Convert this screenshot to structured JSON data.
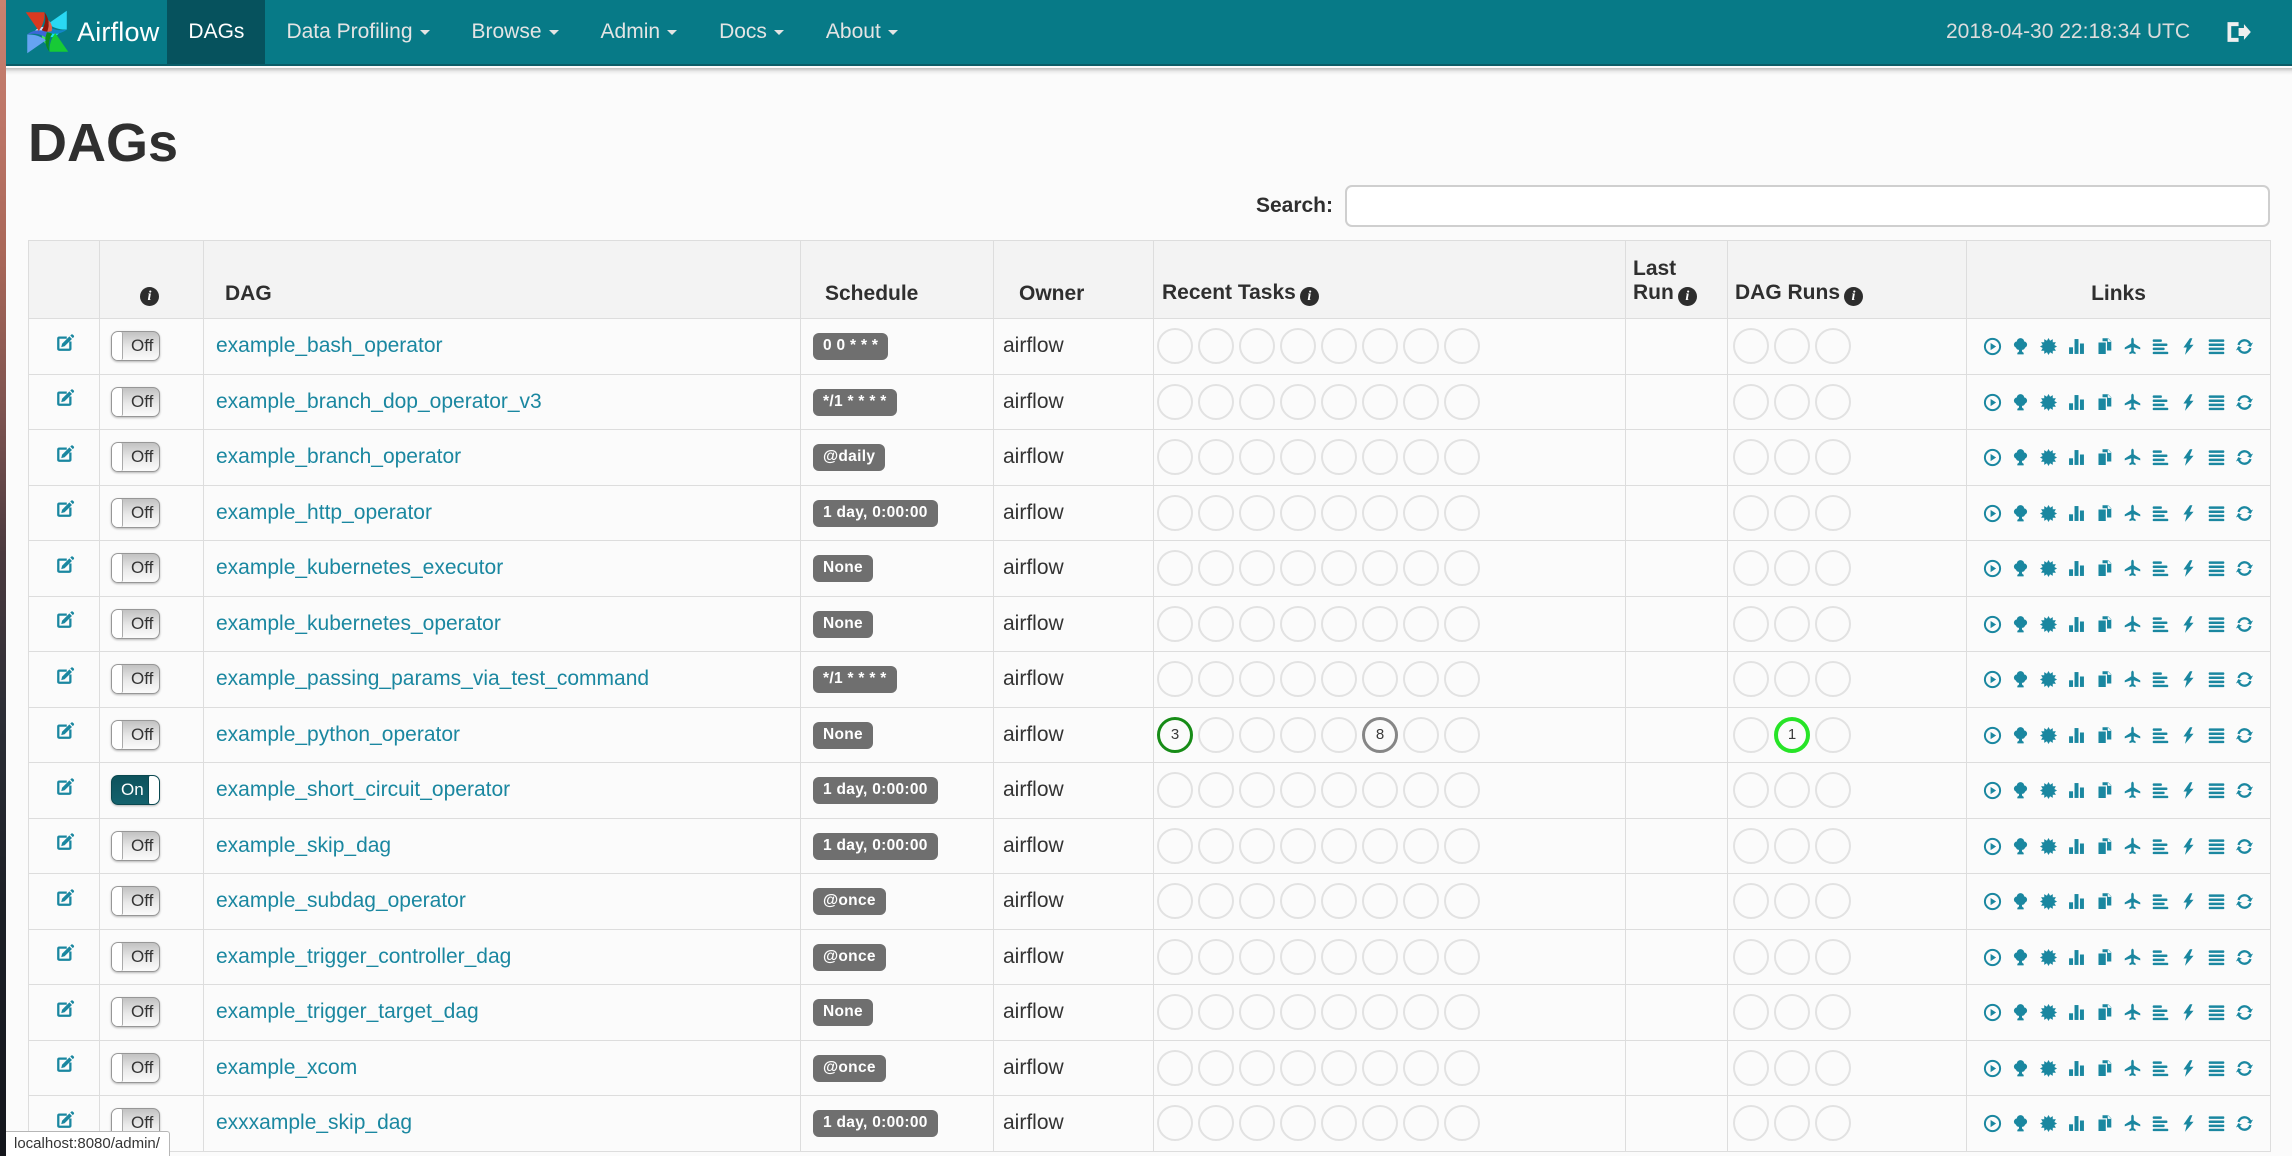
{
  "colors": {
    "accent": "#1a87a0",
    "navbar_bg": "#077a87",
    "navbar_active_bg": "#06525d",
    "toggle_on_bg": "#115f6a",
    "badge_bg": "#6f6f6f",
    "state_success": "#178c17",
    "state_queued": "#868686",
    "state_running": "#27e427",
    "empty_circle": "#e2e2e2"
  },
  "navbar": {
    "brand": "Airflow",
    "items": [
      {
        "label": "DAGs",
        "active": true,
        "dropdown": false
      },
      {
        "label": "Data Profiling",
        "active": false,
        "dropdown": true
      },
      {
        "label": "Browse",
        "active": false,
        "dropdown": true
      },
      {
        "label": "Admin",
        "active": false,
        "dropdown": true
      },
      {
        "label": "Docs",
        "active": false,
        "dropdown": true
      },
      {
        "label": "About",
        "active": false,
        "dropdown": true
      }
    ],
    "clock": "2018-04-30 22:18:34 UTC"
  },
  "page": {
    "title": "DAGs",
    "search_label": "Search:",
    "search_value": "",
    "status_bar_text": "localhost:8080/admin/"
  },
  "table": {
    "headers": {
      "edit": "",
      "info": "",
      "dag": "DAG",
      "schedule": "Schedule",
      "owner": "Owner",
      "recent_tasks": "Recent Tasks",
      "last_run": "Last Run",
      "dag_runs": "DAG Runs",
      "links": "Links"
    },
    "recent_task_slots": 8,
    "dag_run_slots": 3,
    "toggle_on_label": "On",
    "toggle_off_label": "Off",
    "link_icons": [
      "play-circle",
      "tree",
      "burst",
      "bar-chart",
      "duplicate",
      "plane",
      "align-left",
      "flash",
      "align-justify",
      "refresh"
    ],
    "rows": [
      {
        "dag_id": "example_bash_operator",
        "schedule": "0 0 * * *",
        "owner": "airflow",
        "enabled": false,
        "last_run": "",
        "recent_tasks": [],
        "dag_runs": []
      },
      {
        "dag_id": "example_branch_dop_operator_v3",
        "schedule": "*/1 * * * *",
        "owner": "airflow",
        "enabled": false,
        "last_run": "",
        "recent_tasks": [],
        "dag_runs": []
      },
      {
        "dag_id": "example_branch_operator",
        "schedule": "@daily",
        "owner": "airflow",
        "enabled": false,
        "last_run": "",
        "recent_tasks": [],
        "dag_runs": []
      },
      {
        "dag_id": "example_http_operator",
        "schedule": "1 day, 0:00:00",
        "owner": "airflow",
        "enabled": false,
        "last_run": "",
        "recent_tasks": [],
        "dag_runs": []
      },
      {
        "dag_id": "example_kubernetes_executor",
        "schedule": "None",
        "owner": "airflow",
        "enabled": false,
        "last_run": "",
        "recent_tasks": [],
        "dag_runs": []
      },
      {
        "dag_id": "example_kubernetes_operator",
        "schedule": "None",
        "owner": "airflow",
        "enabled": false,
        "last_run": "",
        "recent_tasks": [],
        "dag_runs": []
      },
      {
        "dag_id": "example_passing_params_via_test_command",
        "schedule": "*/1 * * * *",
        "owner": "airflow",
        "enabled": false,
        "last_run": "",
        "recent_tasks": [],
        "dag_runs": []
      },
      {
        "dag_id": "example_python_operator",
        "schedule": "None",
        "owner": "airflow",
        "enabled": false,
        "last_run": "",
        "recent_tasks": [
          {
            "slot": 0,
            "state": "success",
            "count": "3"
          },
          {
            "slot": 5,
            "state": "queued",
            "count": "8"
          }
        ],
        "dag_runs": [
          {
            "slot": 1,
            "state": "running",
            "count": "1"
          }
        ]
      },
      {
        "dag_id": "example_short_circuit_operator",
        "schedule": "1 day, 0:00:00",
        "owner": "airflow",
        "enabled": true,
        "last_run": "",
        "recent_tasks": [],
        "dag_runs": []
      },
      {
        "dag_id": "example_skip_dag",
        "schedule": "1 day, 0:00:00",
        "owner": "airflow",
        "enabled": false,
        "last_run": "",
        "recent_tasks": [],
        "dag_runs": []
      },
      {
        "dag_id": "example_subdag_operator",
        "schedule": "@once",
        "owner": "airflow",
        "enabled": false,
        "last_run": "",
        "recent_tasks": [],
        "dag_runs": []
      },
      {
        "dag_id": "example_trigger_controller_dag",
        "schedule": "@once",
        "owner": "airflow",
        "enabled": false,
        "last_run": "",
        "recent_tasks": [],
        "dag_runs": []
      },
      {
        "dag_id": "example_trigger_target_dag",
        "schedule": "None",
        "owner": "airflow",
        "enabled": false,
        "last_run": "",
        "recent_tasks": [],
        "dag_runs": []
      },
      {
        "dag_id": "example_xcom",
        "schedule": "@once",
        "owner": "airflow",
        "enabled": false,
        "last_run": "",
        "recent_tasks": [],
        "dag_runs": []
      },
      {
        "dag_id": "exxxample_skip_dag",
        "schedule": "1 day, 0:00:00",
        "owner": "airflow",
        "enabled": false,
        "last_run": "",
        "recent_tasks": [],
        "dag_runs": []
      }
    ]
  }
}
